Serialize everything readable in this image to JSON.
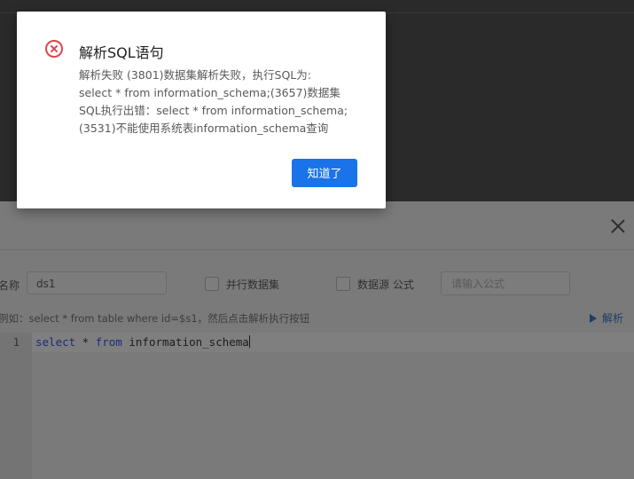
{
  "dialog": {
    "title": "解析SQL语句",
    "message_lines": [
      "解析失败 (3801)数据集解析失败，执行SQL为:",
      "select * from information_schema;(3657)数据集",
      "SQL执行出错：select * from information_schema;",
      "(3531)不能使用系统表information_schema查询"
    ],
    "ok_label": "知道了",
    "icon": "error-circle-icon",
    "accent_color": "#1a73e8",
    "error_color": "#e0454b"
  },
  "panel": {
    "name_label": "名称",
    "name_value": "ds1",
    "parallel_label": "并行数据集",
    "datasource_formula_label": "数据源 公式",
    "formula_placeholder": "请输入公式",
    "hint": "例如：select * from table where id=$s1，然后点击解析执行按钮",
    "parse_label": "解析",
    "editor": {
      "line_number": "1",
      "code": {
        "kw1": "select",
        "mid": " * ",
        "kw2": "from",
        "rest": " information_schema"
      }
    }
  }
}
